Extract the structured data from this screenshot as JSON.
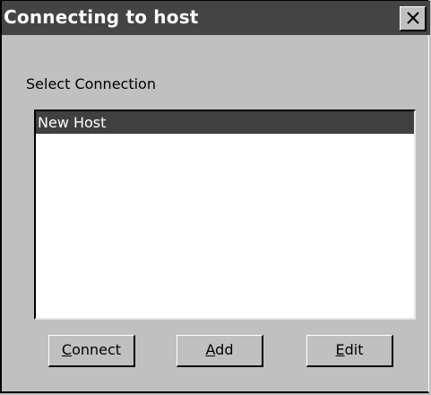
{
  "window": {
    "title": "Connecting to host",
    "close_icon": "close-icon"
  },
  "main": {
    "select_label": "Select Connection",
    "connections": [
      {
        "label": "New Host",
        "selected": true
      }
    ]
  },
  "buttons": {
    "connect": {
      "mnemonic": "C",
      "rest": "onnect"
    },
    "add": {
      "mnemonic": "A",
      "rest": "dd"
    },
    "edit": {
      "mnemonic": "E",
      "rest": "dit"
    }
  },
  "colors": {
    "titlebar": "#444444",
    "selection": "#404040",
    "face": "#c0c0c0"
  }
}
